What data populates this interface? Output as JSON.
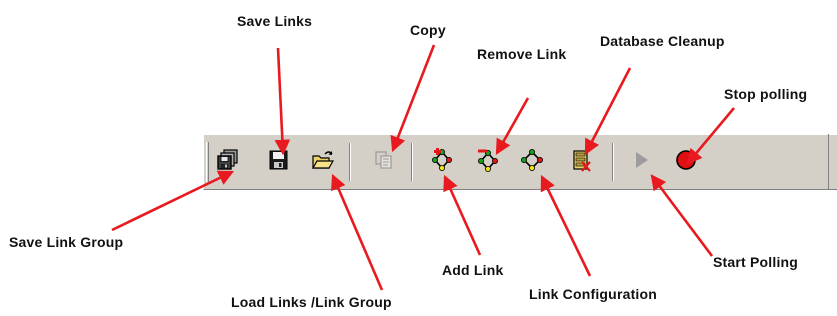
{
  "colors": {
    "toolbar_face": "#d4d0c8",
    "arrow": "#e8191f",
    "label_text": "#111111"
  },
  "toolbar": {
    "buttons": [
      {
        "id": "save-link-group",
        "icon": "stacked-disks-icon",
        "label": "Save Link Group",
        "enabled": true
      },
      {
        "id": "save-links",
        "icon": "floppy-disk-icon",
        "label": "Save Links",
        "enabled": true
      },
      {
        "id": "load-links",
        "icon": "open-folder-icon",
        "label": "Load Links /Link Group",
        "enabled": true
      },
      {
        "id": "copy",
        "icon": "copy-icon",
        "label": "Copy",
        "enabled": false
      },
      {
        "id": "add-link",
        "icon": "add-link-icon",
        "label": "Add Link",
        "enabled": true
      },
      {
        "id": "remove-link",
        "icon": "remove-link-icon",
        "label": "Remove Link",
        "enabled": true
      },
      {
        "id": "link-configuration",
        "icon": "link-configuration-icon",
        "label": "Link Configuration",
        "enabled": true
      },
      {
        "id": "database-cleanup",
        "icon": "database-cleanup-icon",
        "label": "Database Cleanup",
        "enabled": true
      },
      {
        "id": "start-polling",
        "icon": "play-icon",
        "label": "Start Polling",
        "enabled": false
      },
      {
        "id": "stop-polling",
        "icon": "record-icon",
        "label": "Stop polling",
        "enabled": true
      }
    ]
  },
  "callouts": {
    "save_links": "Save Links",
    "copy": "Copy",
    "remove_link": "Remove Link",
    "database_cleanup": "Database Cleanup",
    "stop_polling": "Stop polling",
    "save_link_group": "Save Link Group",
    "add_link": "Add Link",
    "start_polling": "Start Polling",
    "link_configuration": "Link Configuration",
    "load_links": "Load Links /Link Group"
  }
}
